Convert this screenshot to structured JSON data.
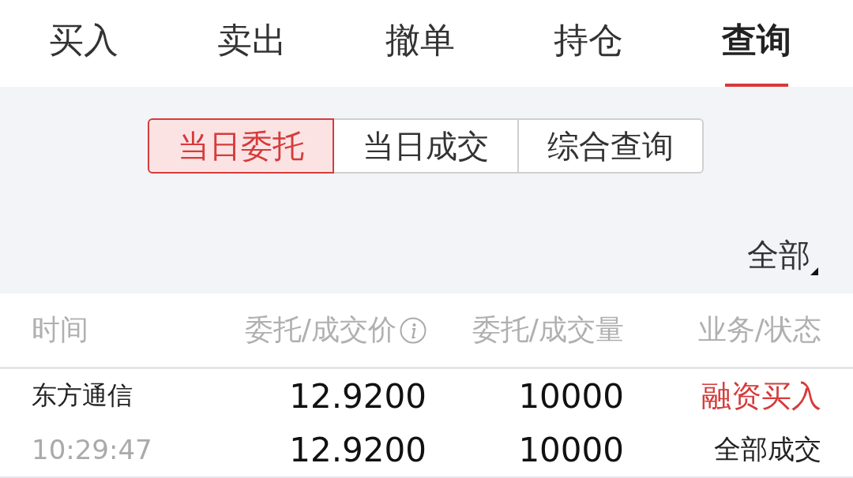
{
  "tabs": [
    {
      "label": "买入",
      "selected": false
    },
    {
      "label": "卖出",
      "selected": false
    },
    {
      "label": "撤单",
      "selected": false
    },
    {
      "label": "持仓",
      "selected": false
    },
    {
      "label": "查询",
      "selected": true
    }
  ],
  "segments": [
    {
      "label": "当日委托",
      "selected": true
    },
    {
      "label": "当日成交",
      "selected": false
    },
    {
      "label": "综合查询",
      "selected": false
    }
  ],
  "filter": {
    "label": "全部"
  },
  "table": {
    "columns": [
      {
        "label": "时间",
        "kind": "plain"
      },
      {
        "label": "委托/成交价",
        "kind": "info"
      },
      {
        "label": "委托/成交量",
        "kind": "plain"
      },
      {
        "label": "业务/状态",
        "kind": "plain"
      }
    ],
    "rows": [
      {
        "name": "东方通信",
        "time": "10:29:47",
        "order_price": "12.9200",
        "deal_price": "12.9200",
        "order_qty": "10000",
        "deal_qty": "10000",
        "business": "融资买入",
        "status": "全部成交",
        "color": "#d63b3b"
      }
    ]
  }
}
